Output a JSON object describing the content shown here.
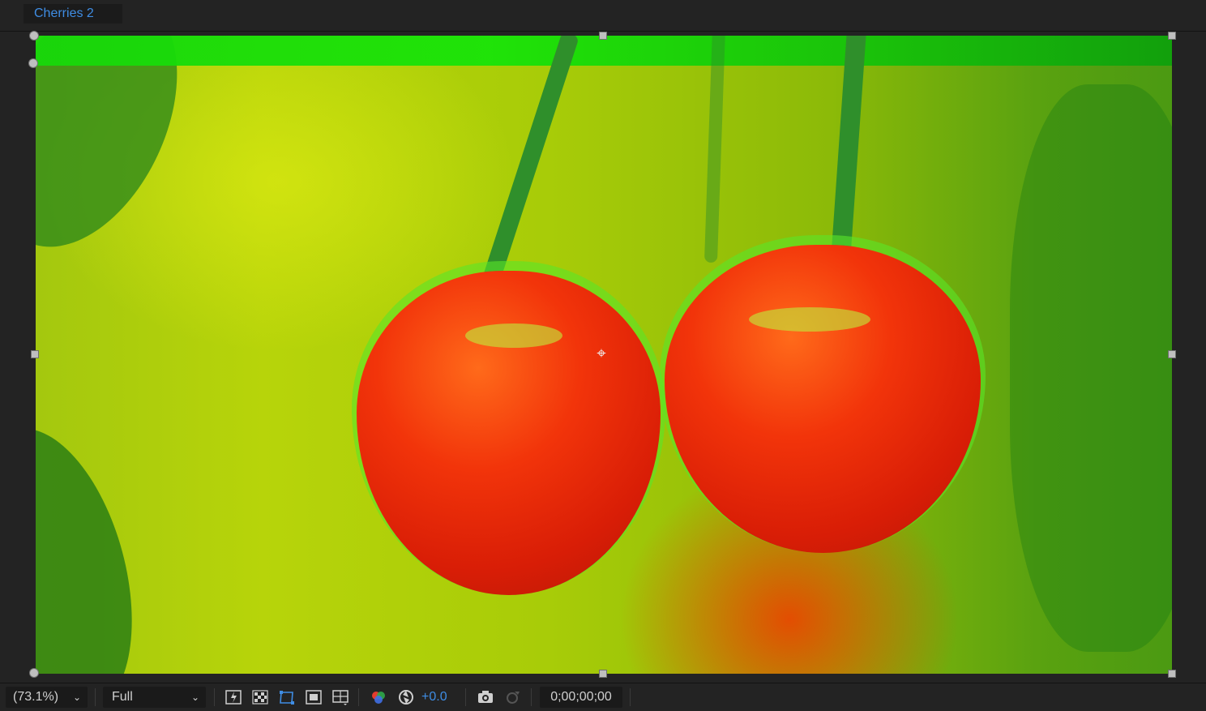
{
  "tab": {
    "label": "Cherries 2"
  },
  "viewer": {
    "zoom": "(73.1%)",
    "resolution": "Full",
    "exposure": "+0.0",
    "timecode": "0;00;00;00"
  },
  "icons": {
    "fast_preview": "fast-preview-icon",
    "transparency_grid": "transparency-grid-icon",
    "mask_path_visibility": "mask-path-icon",
    "region_of_interest": "region-of-interest-icon",
    "grid_guides": "grid-guides-icon",
    "show_channel": "color-channels-icon",
    "reset_exposure": "reset-exposure-icon",
    "snapshot": "camera-icon",
    "show_snapshot": "show-snapshot-icon"
  },
  "colors": {
    "accent": "#3f8de4",
    "panel_bg": "#232323",
    "field_bg": "#1a1a1a"
  }
}
